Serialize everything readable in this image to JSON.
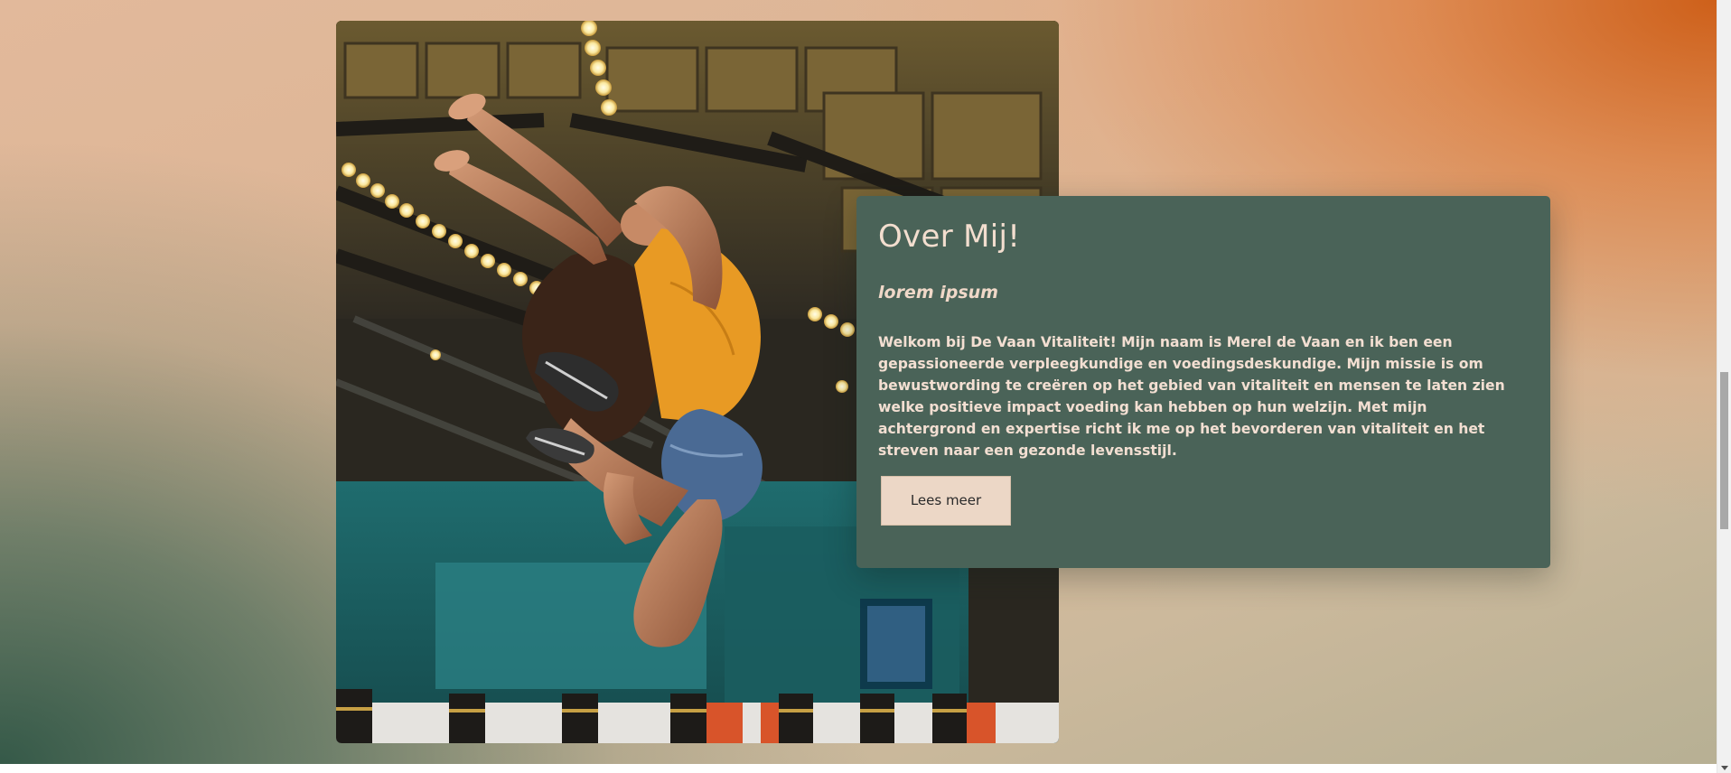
{
  "about": {
    "title": "Over Mij!",
    "subtitle": "lorem ipsum",
    "text": "Welkom bij De Vaan Vitaliteit! Mijn naam is Merel de Vaan en ik ben een gepassioneerde verpleegkundige en voedingsdeskundige. Mijn missie is om bewustwording te creëren op het gebied van vitaliteit en mensen te laten zien welke positieve impact voeding kan hebben op hun welzijn. Met mijn achtergrond en expertise richt ik me op het bevorderen van vitaliteit en het streven naar een gezonde levensstijl.",
    "button_label": "Lees meer"
  },
  "colors": {
    "card_background": "#4a6358",
    "card_text": "#f3dfd2",
    "button_background": "#ecd7c6",
    "accent_orange": "#ce601a",
    "accent_green": "#2c5444"
  },
  "icons": {
    "scroll_down": "scroll-down-arrow-icon"
  }
}
